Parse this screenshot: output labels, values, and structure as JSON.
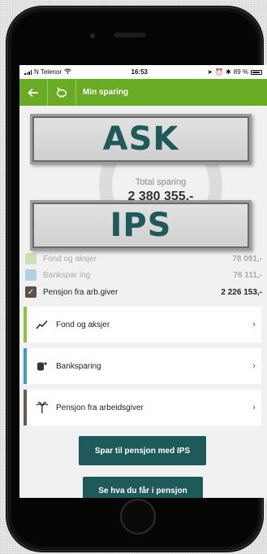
{
  "status_bar": {
    "carrier": "N Telenor",
    "time": "16:53",
    "battery": "89 %"
  },
  "app_bar": {
    "title": "Min sparing"
  },
  "summary": {
    "total_label": "Total sparing",
    "total_value": "2 380 355,-"
  },
  "legend": [
    {
      "name": "Fond og aksjer",
      "amount": "78 091,-",
      "color": "#8cc63f"
    },
    {
      "name": "Bankspar ing",
      "amount": "76 111,-",
      "color": "#3a9bc9"
    },
    {
      "name": "Pensjon fra arb.giver",
      "amount": "2 226 153,-",
      "color": "#5b5146"
    }
  ],
  "cards": [
    {
      "label": "Fond og aksjer",
      "color": "#8cc63f",
      "icon": "chart-line-icon"
    },
    {
      "label": "Banksparing",
      "color": "#3a9bc9",
      "icon": "coins-icon"
    },
    {
      "label": "Pensjon fra arbeidsgiver",
      "color": "#6b5a4a",
      "icon": "palm-tree-icon"
    }
  ],
  "buttons": {
    "ips": "Spar til pensjon med IPS",
    "see_pension": "Se hva du får i pensjon"
  },
  "overlays": {
    "top": "ASK",
    "bottom": "IPS"
  },
  "colors": {
    "brand_green": "#6aab24",
    "teal": "#1f5a5a"
  }
}
